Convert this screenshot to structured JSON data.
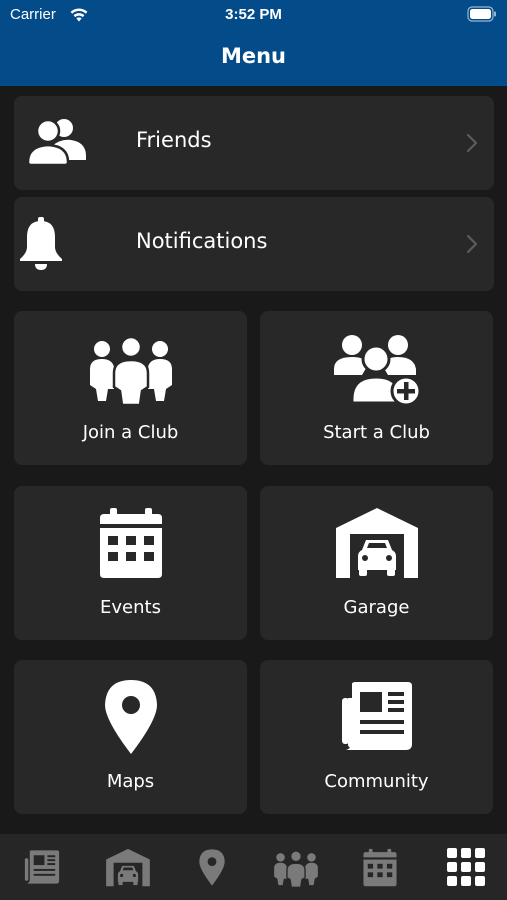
{
  "status_bar": {
    "carrier": "Carrier",
    "time": "3:52 PM"
  },
  "header": {
    "title": "Menu"
  },
  "rows": [
    {
      "label": "Friends",
      "icon": "friends-icon"
    },
    {
      "label": "Notifications",
      "icon": "bell-icon"
    }
  ],
  "tiles": [
    {
      "label": "Join a Club",
      "icon": "people-group-icon"
    },
    {
      "label": "Start a Club",
      "icon": "add-group-icon"
    },
    {
      "label": "Events",
      "icon": "calendar-icon"
    },
    {
      "label": "Garage",
      "icon": "garage-icon"
    },
    {
      "label": "Maps",
      "icon": "map-pin-icon"
    },
    {
      "label": "Community",
      "icon": "newspaper-icon"
    }
  ],
  "tab_bar": {
    "tabs": [
      {
        "icon": "newspaper-icon",
        "active": false
      },
      {
        "icon": "garage-icon",
        "active": false
      },
      {
        "icon": "map-pin-icon",
        "active": false
      },
      {
        "icon": "people-group-icon",
        "active": false
      },
      {
        "icon": "calendar-icon",
        "active": false
      },
      {
        "icon": "grid-menu-icon",
        "active": true
      }
    ]
  },
  "colors": {
    "header": "#044b8a",
    "background": "#191919",
    "card": "#282828",
    "tab_bar": "#262626",
    "tab_inactive": "#7a7a7a",
    "tab_active": "#ffffff"
  }
}
